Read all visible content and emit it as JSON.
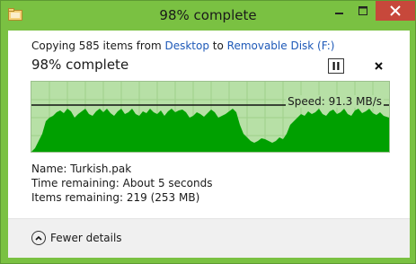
{
  "window": {
    "title": "98% complete",
    "accent_color": "#7ac142",
    "close_color": "#c7483b"
  },
  "copy_line": {
    "prefix": "Copying 585 items from ",
    "source": "Desktop",
    "middle": " to ",
    "destination": "Removable Disk (F:)"
  },
  "progress": {
    "heading": "98% complete",
    "percent": 98
  },
  "graph": {
    "speed_label": "Speed: 91.3 MB/s",
    "fill_color": "#00a000",
    "background_color": "#b7e0a6"
  },
  "details": {
    "name_label": "Name:",
    "name_value": "Turkish.pak",
    "time_label": "Time remaining:",
    "time_value": "About 5 seconds",
    "items_label": "Items remaining:",
    "items_value": "219 (253 MB)"
  },
  "footer": {
    "fewer_details_label": "Fewer details"
  },
  "icons": {
    "title_icon": "folder-copy-icon",
    "pause": "pause-icon",
    "cancel": "close-icon",
    "collapse": "chevron-up-icon"
  }
}
